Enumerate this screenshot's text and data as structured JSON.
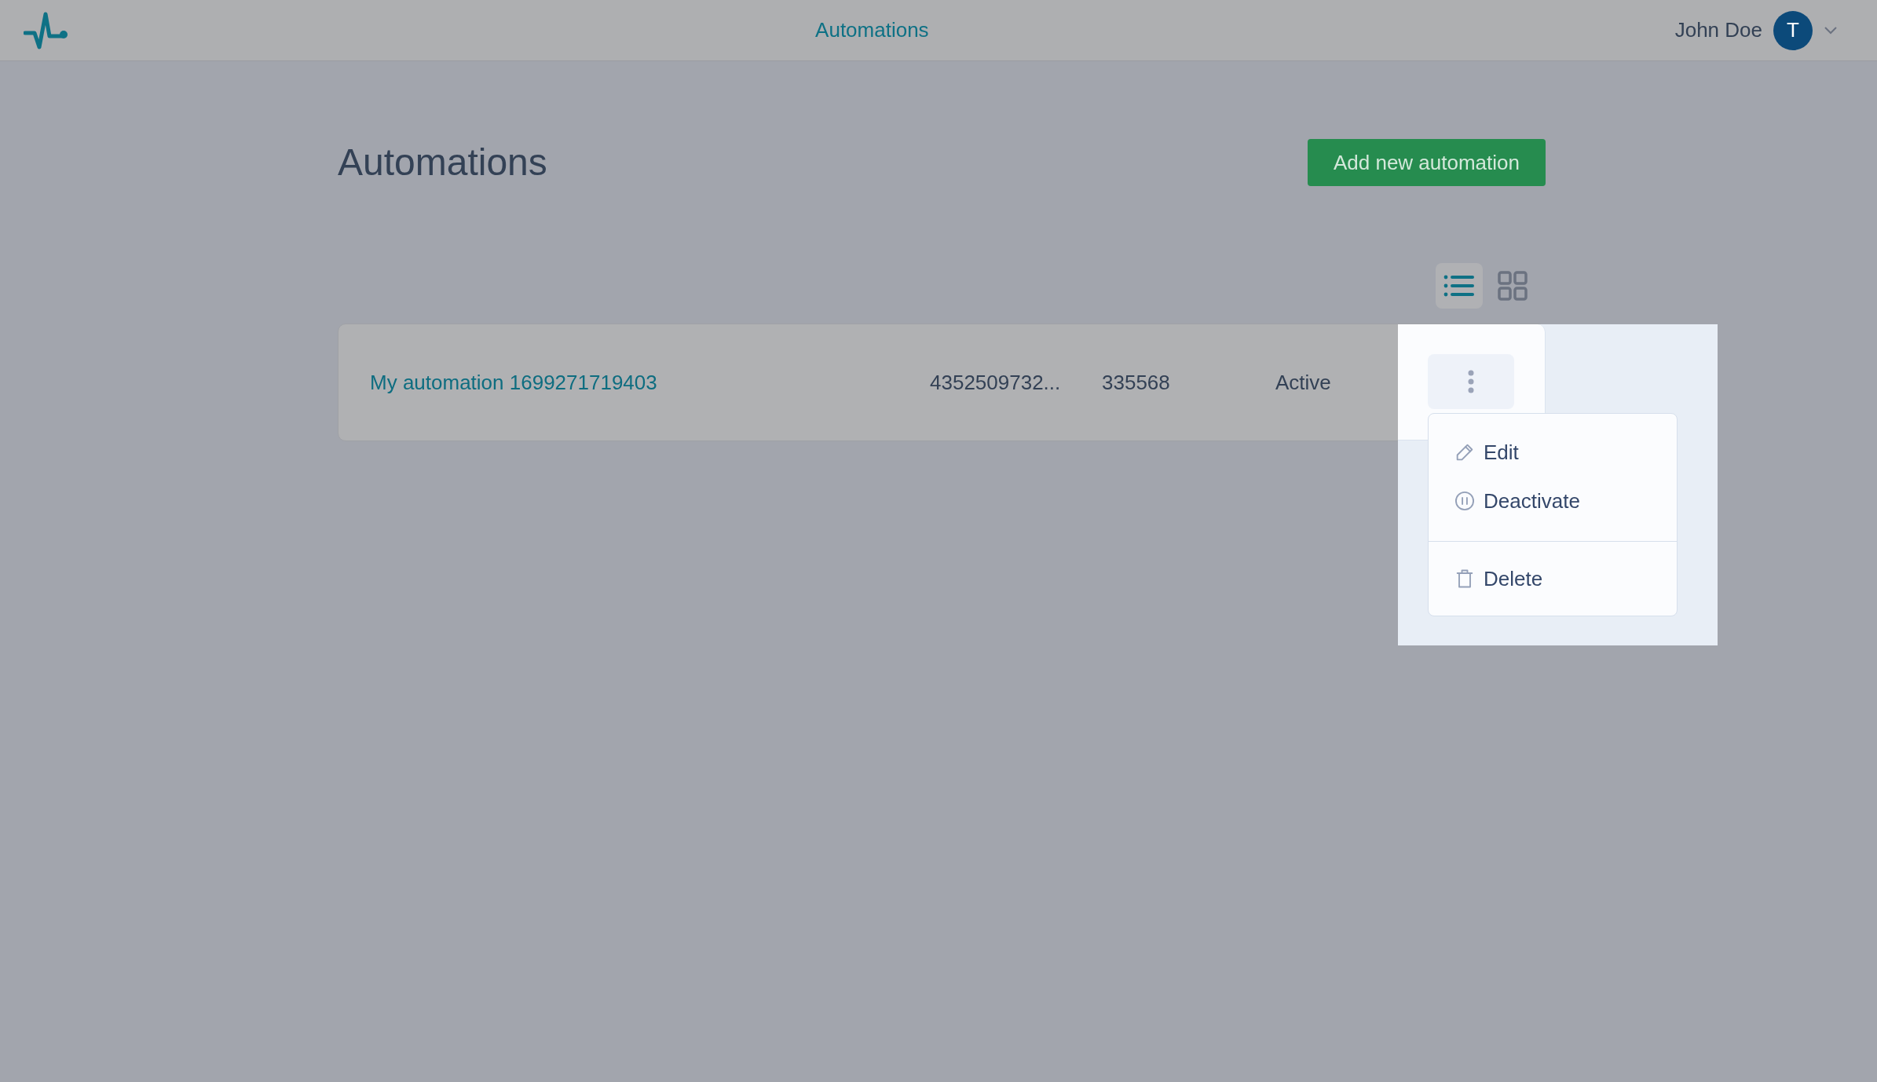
{
  "header": {
    "nav_link": "Automations",
    "user_name": "John Doe",
    "avatar_initial": "T"
  },
  "page": {
    "title": "Automations",
    "add_button": "Add new automation"
  },
  "view_toggle": [
    {
      "kind": "list",
      "selected": true
    },
    {
      "kind": "grid",
      "selected": false
    }
  ],
  "automations": [
    {
      "name": "My automation 1699271719403",
      "column_2": "4352509732...",
      "column_3": "335568",
      "status": "Active",
      "menu_open": true
    }
  ],
  "row_menu": {
    "sections": [
      [
        {
          "kind": "edit",
          "label": "Edit"
        },
        {
          "kind": "pause",
          "label": "Deactivate"
        }
      ],
      [
        {
          "kind": "trash",
          "label": "Delete"
        }
      ]
    ]
  }
}
